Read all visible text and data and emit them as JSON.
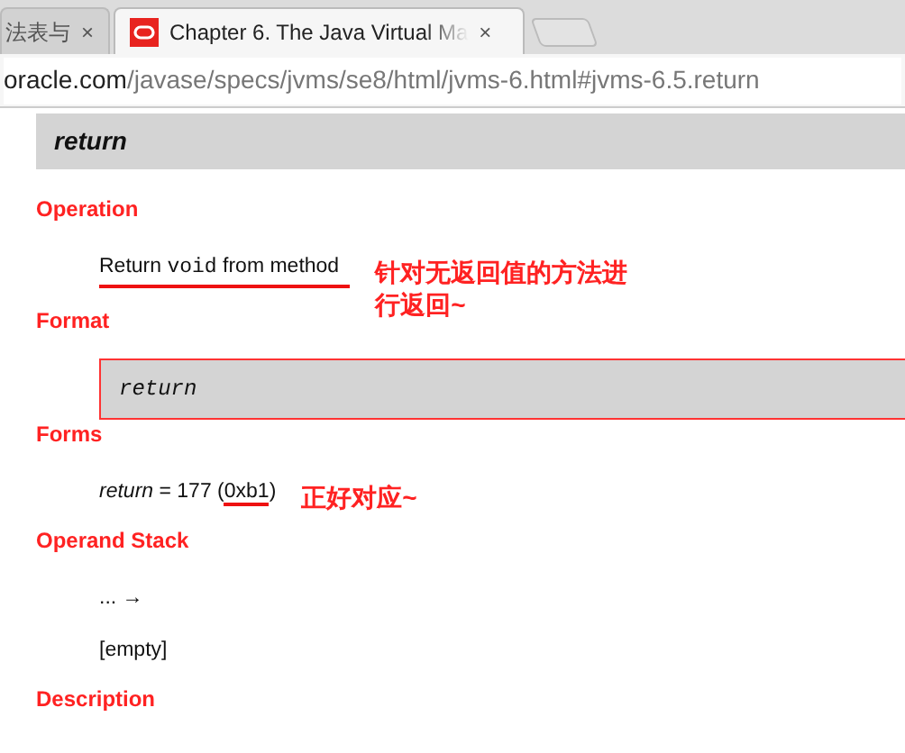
{
  "browser": {
    "tabs": [
      {
        "label": "法表与",
        "selected": false,
        "icon": false,
        "close": "×"
      },
      {
        "label": "Chapter 6. The Java Virtual Ma",
        "selected": true,
        "icon": true,
        "close": "×"
      }
    ],
    "url": {
      "host": "oracle.com",
      "path": "/javase/specs/jvms/se8/html/jvms-6.html#jvms-6.5.return"
    }
  },
  "page": {
    "title": "return",
    "sections": [
      {
        "heading": "Operation",
        "items": [
          {
            "kind": "text",
            "underlined": true,
            "parts": [
              {
                "kind": "plain",
                "text": "Return "
              },
              {
                "kind": "code",
                "text": "void"
              },
              {
                "kind": "plain",
                "text": " from method"
              }
            ],
            "note": "针对无返回值的方法进行返回~"
          }
        ]
      },
      {
        "heading": "Format",
        "items": [
          {
            "kind": "format",
            "parts": [
              {
                "kind": "plain",
                "text": "return"
              }
            ]
          }
        ]
      },
      {
        "heading": "Forms",
        "items": [
          {
            "kind": "text",
            "parts": [
              {
                "kind": "italic",
                "text": "return"
              },
              {
                "kind": "plain",
                "text": " = 177 ("
              },
              {
                "kind": "marked",
                "text": "0xb1"
              },
              {
                "kind": "plain",
                "text": ")"
              }
            ],
            "note": "正好对应~"
          }
        ]
      },
      {
        "heading": "Operand Stack",
        "items": [
          {
            "kind": "text",
            "parts": [
              {
                "kind": "plain",
                "text": "... →"
              }
            ]
          },
          {
            "kind": "text",
            "parts": [
              {
                "kind": "plain",
                "text": "[empty]"
              }
            ]
          }
        ]
      },
      {
        "heading": "Description"
      }
    ]
  }
}
